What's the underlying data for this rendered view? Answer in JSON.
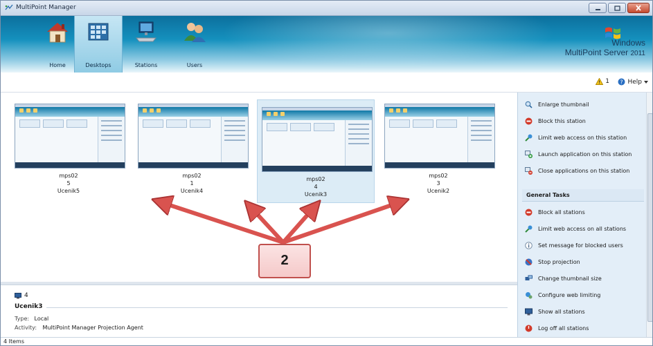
{
  "window": {
    "title": "MultiPoint Manager"
  },
  "nav": [
    {
      "label": "Home",
      "icon": "home-icon"
    },
    {
      "label": "Desktops",
      "icon": "desktops-icon"
    },
    {
      "label": "Stations",
      "icon": "stations-icon"
    },
    {
      "label": "Users",
      "icon": "users-icon"
    }
  ],
  "brand": {
    "line1": "Windows",
    "line2": "MultiPoint Server",
    "year": "2011"
  },
  "status": {
    "warning_count": "1",
    "help_label": "Help"
  },
  "thumbnails": [
    {
      "host": "mps02",
      "station": "5",
      "user": "Ucenik5"
    },
    {
      "host": "mps02",
      "station": "1",
      "user": "Ucenik4"
    },
    {
      "host": "mps02",
      "station": "4",
      "user": "Ucenik3"
    },
    {
      "host": "mps02",
      "station": "3",
      "user": "Ucenik2"
    }
  ],
  "callout": {
    "text": "2"
  },
  "details": {
    "station_number": "4",
    "name": "Ucenik3",
    "type_label": "Type:",
    "type_value": "Local",
    "activity_label": "Activity:",
    "activity_value": "MultiPoint Manager Projection Agent"
  },
  "station_tasks": [
    {
      "label": "Enlarge thumbnail",
      "icon": "enlarge-icon"
    },
    {
      "label": "Block this station",
      "icon": "block-icon"
    },
    {
      "label": "Limit web access on this station",
      "icon": "limit-web-icon"
    },
    {
      "label": "Launch application on this station",
      "icon": "launch-app-icon"
    },
    {
      "label": "Close applications on this station",
      "icon": "close-apps-icon"
    }
  ],
  "general_tasks_header": "General Tasks",
  "general_tasks": [
    {
      "label": "Block all stations",
      "icon": "block-icon"
    },
    {
      "label": "Limit web access on all stations",
      "icon": "limit-web-icon"
    },
    {
      "label": "Set message for blocked users",
      "icon": "info-icon"
    },
    {
      "label": "Stop projection",
      "icon": "projection-icon"
    },
    {
      "label": "Change thumbnail size",
      "icon": "thumbnail-size-icon"
    },
    {
      "label": "Configure web limiting",
      "icon": "web-config-icon"
    },
    {
      "label": "Show all stations",
      "icon": "monitor-icon"
    },
    {
      "label": "Log off all stations",
      "icon": "logoff-icon"
    }
  ],
  "statusbar": {
    "items_text": "4 Items"
  },
  "colors": {
    "ribbon": "#1591be",
    "selected": "#dcecf6",
    "callout_border": "#c0504d",
    "arrow": "#d9534f"
  }
}
